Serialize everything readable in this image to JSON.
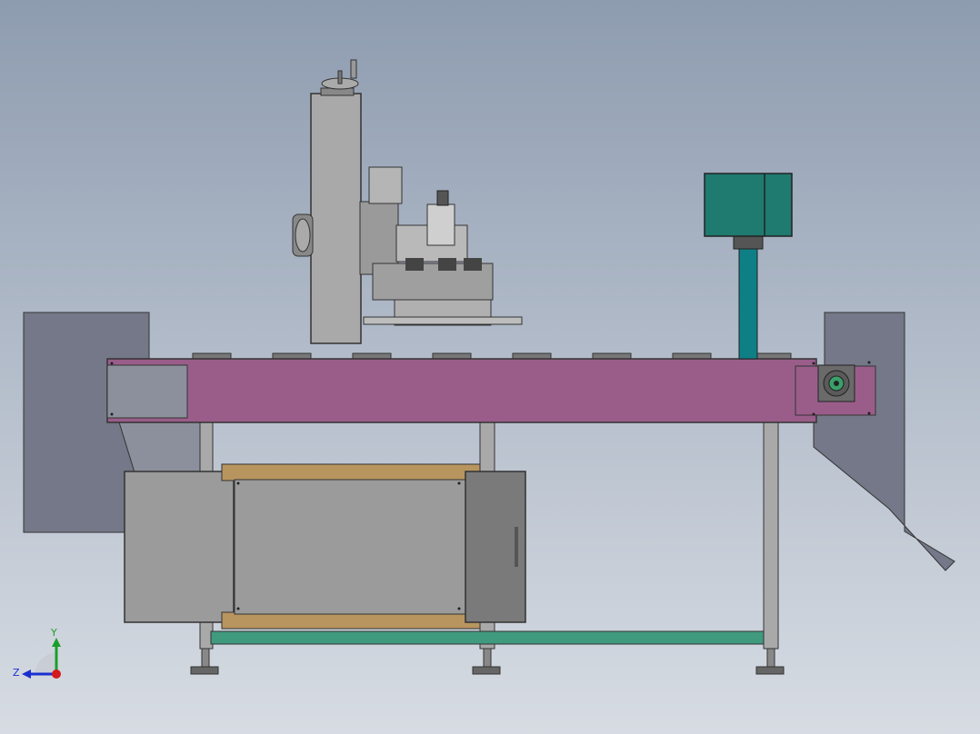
{
  "viewport": {
    "background_top": "#8e9cb0",
    "background_bottom": "#d7dce3"
  },
  "model": {
    "conveyor_belt_color": "#9a5d8a",
    "motor_color": "#1f7a70",
    "motor_pillar_color": "#0f7f86",
    "frame_color": "#a9a9a9",
    "bottom_rail_color": "#3f9a7e",
    "wood_frame_color": "#b8955f",
    "cabinet_color": "#9b9b9b",
    "hopper_color": "#747888"
  },
  "triad": {
    "y_label": "Y",
    "z_label": "Z",
    "y_axis_color": "#1a9e2a",
    "z_axis_color": "#1a2fd0",
    "x_axis_color": "#d41a1a"
  }
}
